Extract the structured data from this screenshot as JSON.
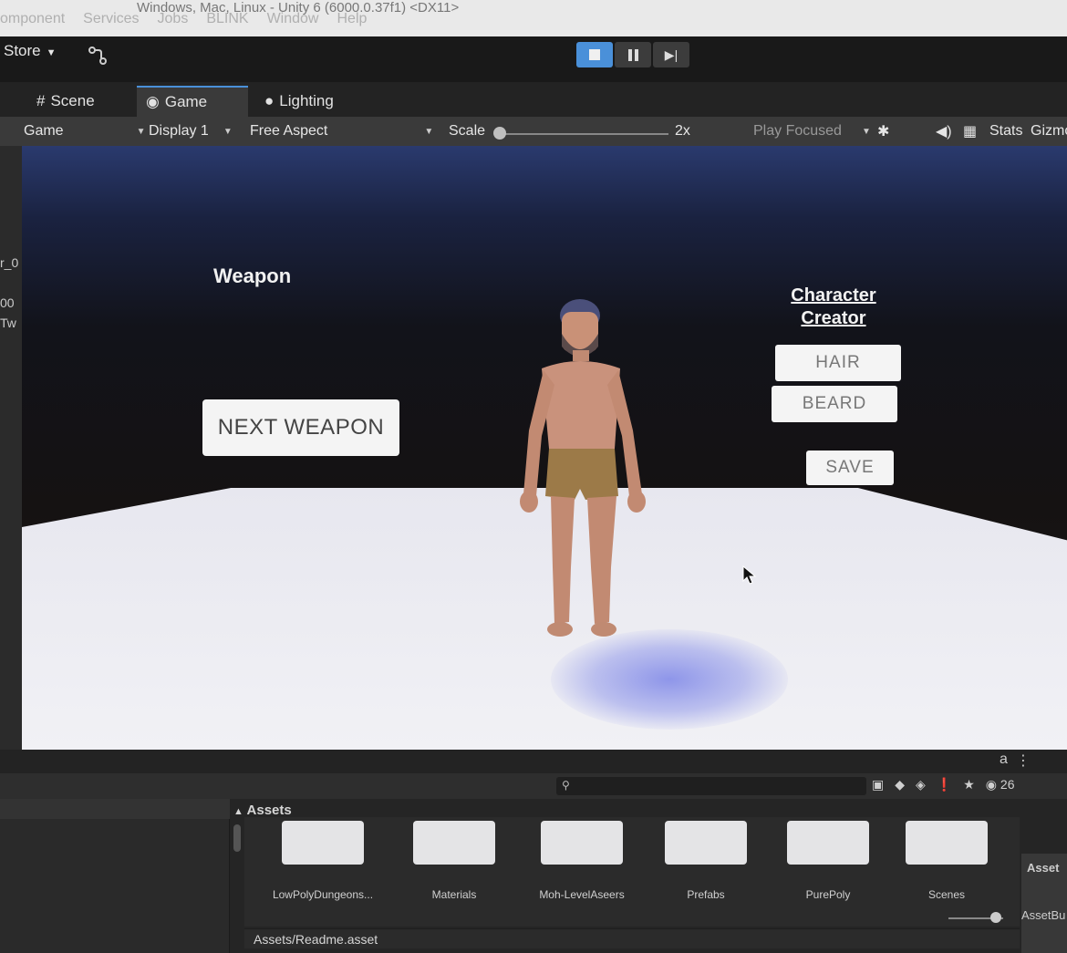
{
  "window": {
    "title": "Windows, Mac, Linux - Unity 6 (6000.0.37f1) <DX11>",
    "menu": [
      "omponent",
      "Services",
      "Jobs",
      "BLINK",
      "Window",
      "Help"
    ]
  },
  "toolbar": {
    "store_label": "Store"
  },
  "tabs": [
    {
      "label": "Scene",
      "icon": "grid-icon"
    },
    {
      "label": "Game",
      "icon": "gamepad-icon",
      "active": true
    },
    {
      "label": "Lighting",
      "icon": "bulb-icon"
    }
  ],
  "game_toolbar": {
    "game_dropdown": "Game",
    "display": "Display 1",
    "aspect": "Free Aspect",
    "scale_label": "Scale",
    "scale_value": "2x",
    "play_mode": "Play Focused",
    "stats": "Stats",
    "gizmos": "Gizmo"
  },
  "left_strip": [
    "r_0",
    "00",
    "Tw"
  ],
  "game_ui": {
    "weapon_label": "Weapon",
    "next_weapon": "NEXT WEAPON",
    "character_creator": [
      "Character",
      "Creator"
    ],
    "hair": "HAIR",
    "beard": "BEARD",
    "save": "SAVE"
  },
  "project": {
    "visible_count": "26",
    "assets_header": "Assets",
    "folders": [
      "LowPolyDungeons...",
      "Materials",
      "Moh-LevelAseers",
      "Prefabs",
      "PurePoly",
      "Scenes"
    ],
    "selected_path": "Assets/Readme.asset",
    "inspector_top": "Asset",
    "inspector_bottom": "AssetBu"
  },
  "colors": {
    "accent": "#4a90d9",
    "editor_bg": "#232323",
    "floor": "#ececf2"
  }
}
